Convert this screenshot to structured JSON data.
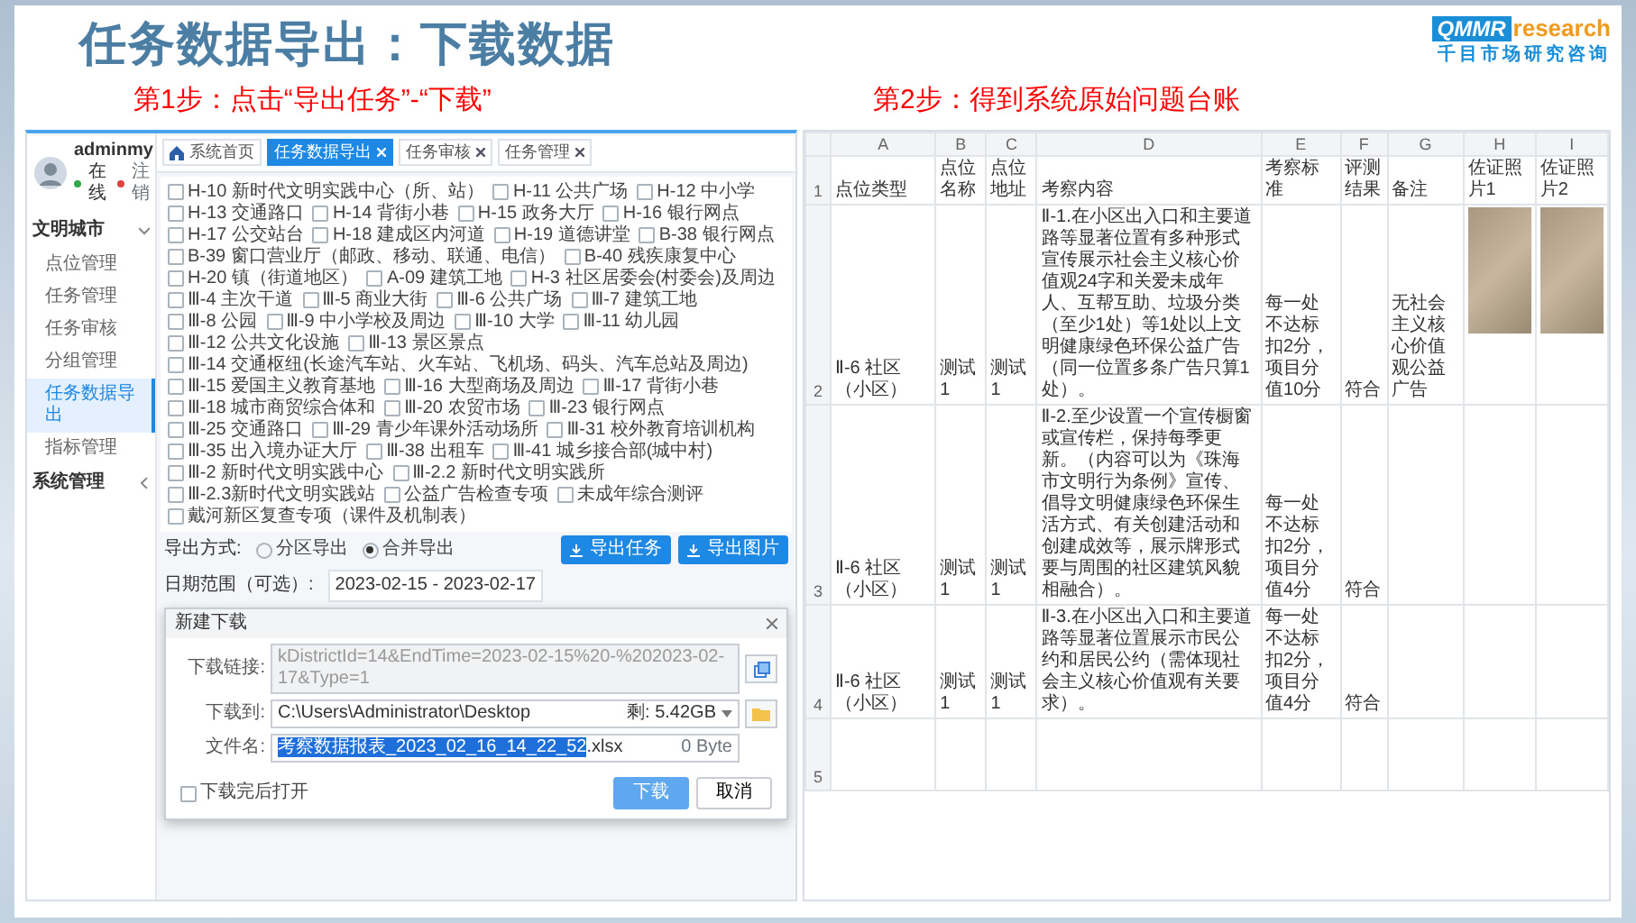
{
  "slide": {
    "title": "任务数据导出：下载数据",
    "logo": {
      "mark": "QMMR",
      "word": "research",
      "tagline": "千目市场研究咨询"
    }
  },
  "steps": [
    {
      "label": "第1步：点击“导出任务”-“下载”"
    },
    {
      "label": "第2步：得到系统原始问题台账"
    }
  ],
  "admin_app": {
    "user": {
      "name": "adminmy",
      "status": "在线",
      "logout": "注销"
    },
    "sidebar": {
      "items": [
        {
          "label": "文明城市",
          "expanded": true,
          "children": [
            {
              "label": "点位管理",
              "selected": false
            },
            {
              "label": "任务管理",
              "selected": false
            },
            {
              "label": "任务审核",
              "selected": false
            },
            {
              "label": "分组管理",
              "selected": false
            },
            {
              "label": "任务数据导出",
              "selected": true
            },
            {
              "label": "指标管理",
              "selected": false
            }
          ]
        },
        {
          "label": "系统管理",
          "expanded": false
        }
      ]
    },
    "tabs": [
      {
        "label": "系统首页",
        "kind": "home",
        "selected": false
      },
      {
        "label": "任务数据导出",
        "kind": "closable",
        "selected": true
      },
      {
        "label": "任务审核",
        "kind": "closable",
        "selected": false
      },
      {
        "label": "任务管理",
        "kind": "closable",
        "selected": false
      }
    ],
    "checklist": [
      {
        "label": "H-10 新时代文明实践中心（所、站）",
        "checked": false
      },
      {
        "label": "H-11 公共广场",
        "checked": false
      },
      {
        "label": "H-12 中小学",
        "checked": false
      },
      {
        "label": "H-13 交通路口",
        "checked": false
      },
      {
        "label": "H-14 背街小巷",
        "checked": false
      },
      {
        "label": "H-15 政务大厅",
        "checked": false
      },
      {
        "label": "H-16 银行网点",
        "checked": false
      },
      {
        "label": "H-17 公交站台",
        "checked": false
      },
      {
        "label": "H-18 建成区内河道",
        "checked": false
      },
      {
        "label": "H-19 道德讲堂",
        "checked": false
      },
      {
        "label": "B-38 银行网点",
        "checked": false
      },
      {
        "label": "B-39 窗口营业厅（邮政、移动、联通、电信）",
        "checked": false
      },
      {
        "label": "B-40 残疾康复中心",
        "checked": false
      },
      {
        "label": "H-20 镇（街道地区）",
        "checked": false
      },
      {
        "label": "A-09 建筑工地",
        "checked": false
      },
      {
        "label": "H-3 社区居委会(村委会)及周边",
        "checked": false
      },
      {
        "label": "Ⅲ-4 主次干道",
        "checked": false
      },
      {
        "label": "Ⅲ-5 商业大街",
        "checked": false
      },
      {
        "label": "Ⅲ-6 公共广场",
        "checked": false
      },
      {
        "label": "Ⅲ-7 建筑工地",
        "checked": false
      },
      {
        "label": "Ⅲ-8 公园",
        "checked": false
      },
      {
        "label": "Ⅲ-9 中小学校及周边",
        "checked": false
      },
      {
        "label": "Ⅲ-10 大学",
        "checked": false
      },
      {
        "label": "Ⅲ-11 幼儿园",
        "checked": false
      },
      {
        "label": "Ⅲ-12 公共文化设施",
        "checked": false
      },
      {
        "label": "Ⅲ-13 景区景点",
        "checked": false
      },
      {
        "label": "Ⅲ-14 交通枢纽(长途汽车站、火车站、飞机场、码头、汽车总站及周边)",
        "checked": false
      },
      {
        "label": "Ⅲ-15 爱国主义教育基地",
        "checked": false
      },
      {
        "label": "Ⅲ-16 大型商场及周边",
        "checked": false
      },
      {
        "label": "Ⅲ-17 背街小巷",
        "checked": false
      },
      {
        "label": "Ⅲ-18 城市商贸综合体和",
        "checked": false
      },
      {
        "label": "Ⅲ-20 农贸市场",
        "checked": false
      },
      {
        "label": "Ⅲ-23 银行网点",
        "checked": false
      },
      {
        "label": "Ⅲ-25 交通路口",
        "checked": false
      },
      {
        "label": "Ⅲ-29 青少年课外活动场所",
        "checked": false
      },
      {
        "label": "Ⅲ-31 校外教育培训机构",
        "checked": false
      },
      {
        "label": "Ⅲ-35 出入境办证大厅",
        "checked": false
      },
      {
        "label": "Ⅲ-38 出租车",
        "checked": false
      },
      {
        "label": "Ⅲ-41 城乡接合部(城中村)",
        "checked": false
      },
      {
        "label": "Ⅲ-2 新时代文明实践中心",
        "checked": false
      },
      {
        "label": "Ⅲ-2.2 新时代文明实践所",
        "checked": false
      },
      {
        "label": "Ⅲ-2.3新时代文明实践站",
        "checked": false
      },
      {
        "label": "公益广告检查专项",
        "checked": false
      },
      {
        "label": "未成年综合测评",
        "checked": false
      },
      {
        "label": "戴河新区复查专项（课件及机制表）",
        "checked": false
      }
    ],
    "export_form": {
      "mode_label": "导出方式:",
      "modes": [
        {
          "label": "分区导出",
          "selected": false
        },
        {
          "label": "合并导出",
          "selected": true
        }
      ],
      "date_label": "日期范围（可选）:",
      "date_range": "2023-02-15 - 2023-02-17",
      "buttons": [
        "导出任务",
        "导出图片"
      ]
    },
    "download_dialog": {
      "title": "新建下载",
      "fields": [
        {
          "kind": "link",
          "label": "下载链接:",
          "value": "kDistrictId=14&EndTime=2023-02-15%20-%202023-02-17&Type=1"
        },
        {
          "kind": "folder",
          "label": "下载到:",
          "value": "C:\\Users\\Administrator\\Desktop",
          "free_space": "剩: 5.42GB"
        },
        {
          "kind": "filename",
          "label": "文件名:",
          "value_selected": "考察数据报表_2023_02_16_14_22_52",
          "value_rest": ".xlsx",
          "size": "0 Byte"
        }
      ],
      "open_after": {
        "label": "下载完后打开",
        "checked": false
      },
      "buttons": [
        {
          "label": "下载",
          "primary": true
        },
        {
          "label": "取消",
          "primary": false
        }
      ]
    }
  },
  "spreadsheet": {
    "column_letters": [
      "A",
      "B",
      "C",
      "D",
      "E",
      "F",
      "G",
      "H",
      "I"
    ],
    "rows": [
      {
        "number": "1",
        "cells": [
          {
            "kind": "text",
            "text": "点位类型"
          },
          {
            "kind": "text",
            "text": "点位名称"
          },
          {
            "kind": "text",
            "text": "点位地址"
          },
          {
            "kind": "text",
            "text": "考察内容"
          },
          {
            "kind": "text",
            "text": "考察标准"
          },
          {
            "kind": "text",
            "text": "评测结果"
          },
          {
            "kind": "text",
            "text": "备注"
          },
          {
            "kind": "text",
            "text": "佐证照片1"
          },
          {
            "kind": "text",
            "text": "佐证照片2"
          }
        ]
      },
      {
        "number": "2",
        "cells": [
          {
            "kind": "text",
            "text": "Ⅱ-6 社区（小区）"
          },
          {
            "kind": "text",
            "text": "测试1"
          },
          {
            "kind": "text",
            "text": "测试1"
          },
          {
            "kind": "text",
            "text": "Ⅱ-1.在小区出入口和主要道路等显著位置有多种形式宣传展示社会主义核心价值观24字和关爱未成年人、互帮互助、垃圾分类（至少1处）等1处以上文明健康绿色环保公益广告（同一位置多条广告只算1处）。"
          },
          {
            "kind": "text",
            "text": "每一处不达标扣2分，项目分值10分"
          },
          {
            "kind": "text",
            "text": "符合"
          },
          {
            "kind": "text",
            "text": "无社会主义核心价值观公益广告"
          },
          {
            "kind": "photo"
          },
          {
            "kind": "photo"
          }
        ]
      },
      {
        "number": "3",
        "cells": [
          {
            "kind": "text",
            "text": "Ⅱ-6 社区（小区）"
          },
          {
            "kind": "text",
            "text": "测试1"
          },
          {
            "kind": "text",
            "text": "测试1"
          },
          {
            "kind": "text",
            "text": "Ⅱ-2.至少设置一个宣传橱窗或宣传栏，保持每季更新。（内容可以为《珠海市文明行为条例》宣传、倡导文明健康绿色环保生活方式、有关创建活动和创建成效等，展示牌形式要与周围的社区建筑风貌相融合）。"
          },
          {
            "kind": "text",
            "text": "每一处不达标扣2分，项目分值4分"
          },
          {
            "kind": "text",
            "text": "符合"
          },
          {
            "kind": "empty"
          },
          {
            "kind": "empty"
          },
          {
            "kind": "empty"
          }
        ]
      },
      {
        "number": "4",
        "cells": [
          {
            "kind": "text",
            "text": "Ⅱ-6 社区（小区）"
          },
          {
            "kind": "text",
            "text": "测试1"
          },
          {
            "kind": "text",
            "text": "测试1"
          },
          {
            "kind": "text",
            "text": "Ⅱ-3.在小区出入口和主要道路等显著位置展示市民公约和居民公约（需体现社会主义核心价值观有关要求）。"
          },
          {
            "kind": "text",
            "text": "每一处不达标扣2分，项目分值4分"
          },
          {
            "kind": "text",
            "text": "符合"
          },
          {
            "kind": "empty"
          },
          {
            "kind": "empty"
          },
          {
            "kind": "empty"
          }
        ]
      },
      {
        "number": "5",
        "cells": [
          {
            "kind": "empty"
          },
          {
            "kind": "empty"
          },
          {
            "kind": "empty"
          },
          {
            "kind": "empty"
          },
          {
            "kind": "empty"
          },
          {
            "kind": "empty"
          },
          {
            "kind": "empty"
          },
          {
            "kind": "empty"
          },
          {
            "kind": "empty"
          }
        ]
      }
    ]
  }
}
